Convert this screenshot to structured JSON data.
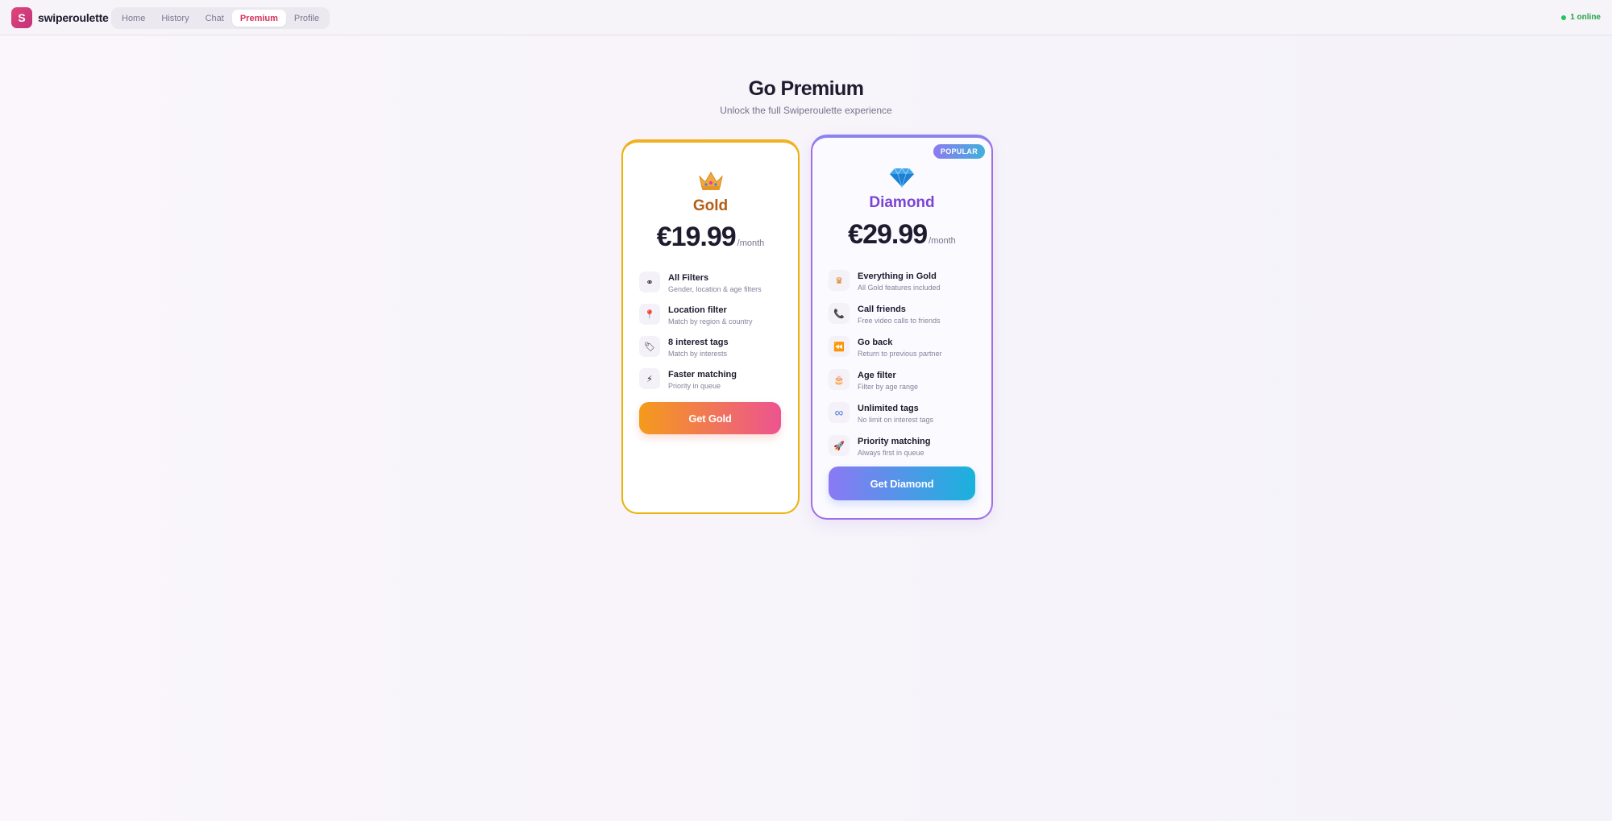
{
  "brand": {
    "logo_letter": "S",
    "name": "swiperoulette"
  },
  "nav": {
    "tabs": [
      {
        "label": "Home",
        "active": false
      },
      {
        "label": "History",
        "active": false
      },
      {
        "label": "Chat",
        "active": false
      },
      {
        "label": "Premium",
        "active": true
      },
      {
        "label": "Profile",
        "active": false
      }
    ]
  },
  "status": {
    "online_text": "1 online",
    "online_color": "#22c55e"
  },
  "header": {
    "title": "Go Premium",
    "subtitle": "Unlock the full Swiperoulette experience"
  },
  "plans": {
    "gold": {
      "icon": "crown-icon",
      "name": "Gold",
      "price": "€19.99",
      "period": "/month",
      "accent": "#eab308",
      "features": [
        {
          "icon": "glasses-icon",
          "glyph": "⚭",
          "title": "All Filters",
          "desc": "Gender, location & age filters"
        },
        {
          "icon": "pin-icon",
          "glyph": "📍",
          "title": "Location filter",
          "desc": "Match by region & country"
        },
        {
          "icon": "tag-icon",
          "glyph": "🏷",
          "title": "8 interest tags",
          "desc": "Match by interests"
        },
        {
          "icon": "lightning-icon",
          "glyph": "⚡",
          "title": "Faster matching",
          "desc": "Priority in queue"
        }
      ],
      "cta": "Get Gold"
    },
    "diamond": {
      "icon": "diamond-icon",
      "badge": "POPULAR",
      "name": "Diamond",
      "price": "€29.99",
      "period": "/month",
      "accent": "#a06ee6",
      "features": [
        {
          "icon": "crown-icon",
          "glyph": "♛",
          "title": "Everything in Gold",
          "desc": "All Gold features included"
        },
        {
          "icon": "phone-icon",
          "glyph": "📞",
          "title": "Call friends",
          "desc": "Free video calls to friends"
        },
        {
          "icon": "back-icon",
          "glyph": "⏪",
          "title": "Go back",
          "desc": "Return to previous partner"
        },
        {
          "icon": "cake-icon",
          "glyph": "🎂",
          "title": "Age filter",
          "desc": "Filter by age range"
        },
        {
          "icon": "infinity-icon",
          "glyph": "∞",
          "title": "Unlimited tags",
          "desc": "No limit on interest tags"
        },
        {
          "icon": "rocket-icon",
          "glyph": "🚀",
          "title": "Priority matching",
          "desc": "Always first in queue"
        }
      ],
      "cta": "Get Diamond"
    }
  }
}
